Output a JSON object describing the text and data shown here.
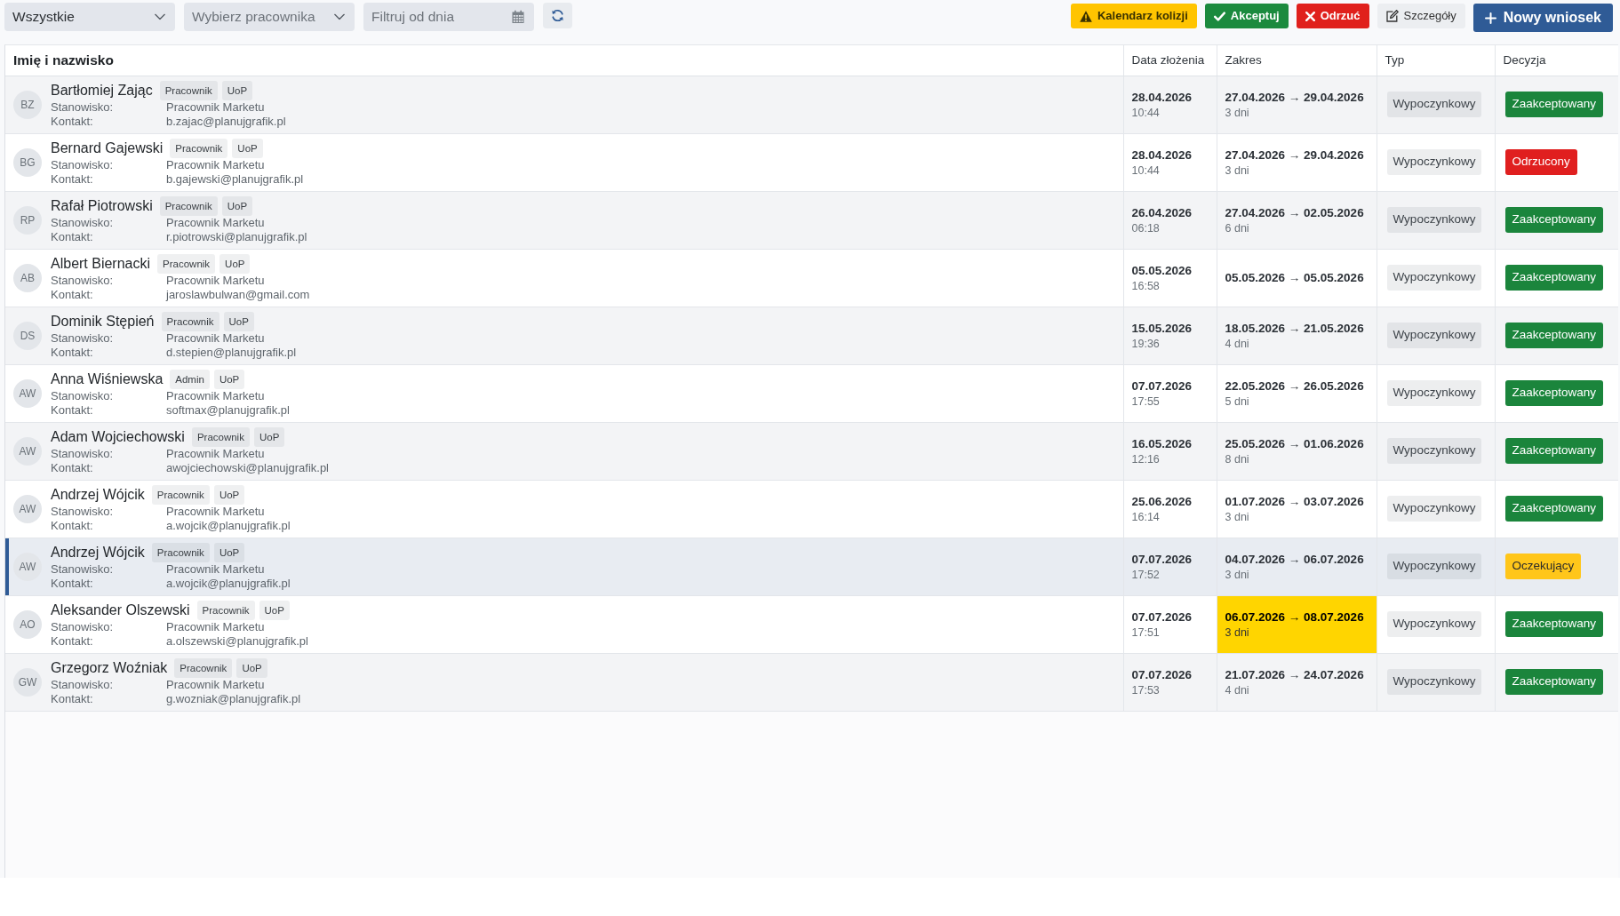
{
  "toolbar": {
    "filters": [
      {
        "kind": "select",
        "value": "Wszystkie"
      },
      {
        "kind": "select",
        "placeholder": "Wybierz pracownika"
      },
      {
        "kind": "date",
        "placeholder": "Filtruj od dnia"
      }
    ],
    "actions": [
      {
        "kind": "collisions",
        "label": "Kalendarz kolizji"
      },
      {
        "kind": "accept",
        "label": "Akceptuj"
      },
      {
        "kind": "reject",
        "label": "Odrzuć"
      },
      {
        "kind": "details",
        "label": "Szczegóły"
      },
      {
        "kind": "new",
        "label": "Nowy wniosek"
      }
    ]
  },
  "table": {
    "columns": [
      "Imię i nazwisko",
      "Data złożenia",
      "Zakres",
      "Typ",
      "Decyzja"
    ],
    "rows": [
      {
        "initials": "BZ",
        "name": "Bartłomiej Zając",
        "tags": [
          "Pracownik",
          "UoP"
        ],
        "position_label": "Stanowisko:",
        "position": "Pracownik Marketu",
        "contact_label": "Kontakt:",
        "contact": "b.zajac@planujgrafik.pl",
        "submitted_date": "28.04.2026",
        "submitted_time": "10:44",
        "range": "27.04.2026 → 29.04.2026",
        "days": "3 dni",
        "range_conflict": false,
        "type": "Wypoczynkowy",
        "decision": {
          "kind": "accepted",
          "label": "Zaakceptowany"
        },
        "selected": false
      },
      {
        "initials": "BG",
        "name": "Bernard Gajewski",
        "tags": [
          "Pracownik",
          "UoP"
        ],
        "position_label": "Stanowisko:",
        "position": "Pracownik Marketu",
        "contact_label": "Kontakt:",
        "contact": "b.gajewski@planujgrafik.pl",
        "submitted_date": "28.04.2026",
        "submitted_time": "10:44",
        "range": "27.04.2026 → 29.04.2026",
        "days": "3 dni",
        "range_conflict": false,
        "type": "Wypoczynkowy",
        "decision": {
          "kind": "rejected",
          "label": "Odrzucony"
        },
        "selected": false
      },
      {
        "initials": "RP",
        "name": "Rafał Piotrowski",
        "tags": [
          "Pracownik",
          "UoP"
        ],
        "position_label": "Stanowisko:",
        "position": "Pracownik Marketu",
        "contact_label": "Kontakt:",
        "contact": "r.piotrowski@planujgrafik.pl",
        "submitted_date": "26.04.2026",
        "submitted_time": "06:18",
        "range": "27.04.2026 → 02.05.2026",
        "days": "6 dni",
        "range_conflict": false,
        "type": "Wypoczynkowy",
        "decision": {
          "kind": "accepted",
          "label": "Zaakceptowany"
        },
        "selected": false
      },
      {
        "initials": "AB",
        "name": "Albert Biernacki",
        "tags": [
          "Pracownik",
          "UoP"
        ],
        "position_label": "Stanowisko:",
        "position": "Pracownik Marketu",
        "contact_label": "Kontakt:",
        "contact": "jaroslawbulwan@gmail.com",
        "submitted_date": "05.05.2026",
        "submitted_time": "16:58",
        "range": "05.05.2026 → 05.05.2026",
        "range_conflict": false,
        "type": "Wypoczynkowy",
        "decision": {
          "kind": "accepted",
          "label": "Zaakceptowany"
        },
        "selected": false
      },
      {
        "initials": "DS",
        "name": "Dominik Stępień",
        "tags": [
          "Pracownik",
          "UoP"
        ],
        "position_label": "Stanowisko:",
        "position": "Pracownik Marketu",
        "contact_label": "Kontakt:",
        "contact": "d.stepien@planujgrafik.pl",
        "submitted_date": "15.05.2026",
        "submitted_time": "19:36",
        "range": "18.05.2026 → 21.05.2026",
        "days": "4 dni",
        "range_conflict": false,
        "type": "Wypoczynkowy",
        "decision": {
          "kind": "accepted",
          "label": "Zaakceptowany"
        },
        "selected": false
      },
      {
        "initials": "AW",
        "name": "Anna Wiśniewska",
        "tags": [
          "Admin",
          "UoP"
        ],
        "position_label": "Stanowisko:",
        "position": "Pracownik Marketu",
        "contact_label": "Kontakt:",
        "contact": "softmax@planujgrafik.pl",
        "submitted_date": "07.07.2026",
        "submitted_time": "17:55",
        "range": "22.05.2026 → 26.05.2026",
        "days": "5 dni",
        "range_conflict": false,
        "type": "Wypoczynkowy",
        "decision": {
          "kind": "accepted",
          "label": "Zaakceptowany"
        },
        "selected": false
      },
      {
        "initials": "AW",
        "name": "Adam Wojciechowski",
        "tags": [
          "Pracownik",
          "UoP"
        ],
        "position_label": "Stanowisko:",
        "position": "Pracownik Marketu",
        "contact_label": "Kontakt:",
        "contact": "awojciechowski@planujgrafik.pl",
        "submitted_date": "16.05.2026",
        "submitted_time": "12:16",
        "range": "25.05.2026 → 01.06.2026",
        "days": "8 dni",
        "range_conflict": false,
        "type": "Wypoczynkowy",
        "decision": {
          "kind": "accepted",
          "label": "Zaakceptowany"
        },
        "selected": false
      },
      {
        "initials": "AW",
        "name": "Andrzej Wójcik",
        "tags": [
          "Pracownik",
          "UoP"
        ],
        "position_label": "Stanowisko:",
        "position": "Pracownik Marketu",
        "contact_label": "Kontakt:",
        "contact": "a.wojcik@planujgrafik.pl",
        "submitted_date": "25.06.2026",
        "submitted_time": "16:14",
        "range": "01.07.2026 → 03.07.2026",
        "days": "3 dni",
        "range_conflict": false,
        "type": "Wypoczynkowy",
        "decision": {
          "kind": "accepted",
          "label": "Zaakceptowany"
        },
        "selected": false
      },
      {
        "initials": "AW",
        "name": "Andrzej Wójcik",
        "tags": [
          "Pracownik",
          "UoP"
        ],
        "position_label": "Stanowisko:",
        "position": "Pracownik Marketu",
        "contact_label": "Kontakt:",
        "contact": "a.wojcik@planujgrafik.pl",
        "submitted_date": "07.07.2026",
        "submitted_time": "17:52",
        "range": "04.07.2026 → 06.07.2026",
        "days": "3 dni",
        "range_conflict": false,
        "type": "Wypoczynkowy",
        "decision": {
          "kind": "pending",
          "label": "Oczekujący"
        },
        "selected": true
      },
      {
        "initials": "AO",
        "name": "Aleksander Olszewski",
        "tags": [
          "Pracownik",
          "UoP"
        ],
        "position_label": "Stanowisko:",
        "position": "Pracownik Marketu",
        "contact_label": "Kontakt:",
        "contact": "a.olszewski@planujgrafik.pl",
        "submitted_date": "07.07.2026",
        "submitted_time": "17:51",
        "range": "06.07.2026 → 08.07.2026",
        "days": "3 dni",
        "range_conflict": true,
        "type": "Wypoczynkowy",
        "decision": {
          "kind": "accepted",
          "label": "Zaakceptowany"
        },
        "selected": false
      },
      {
        "initials": "GW",
        "name": "Grzegorz Woźniak",
        "tags": [
          "Pracownik",
          "UoP"
        ],
        "position_label": "Stanowisko:",
        "position": "Pracownik Marketu",
        "contact_label": "Kontakt:",
        "contact": "g.wozniak@planujgrafik.pl",
        "submitted_date": "07.07.2026",
        "submitted_time": "17:53",
        "range": "21.07.2026 → 24.07.2026",
        "days": "4 dni",
        "range_conflict": false,
        "type": "Wypoczynkowy",
        "decision": {
          "kind": "accepted",
          "label": "Zaakceptowany"
        },
        "selected": false
      }
    ]
  }
}
